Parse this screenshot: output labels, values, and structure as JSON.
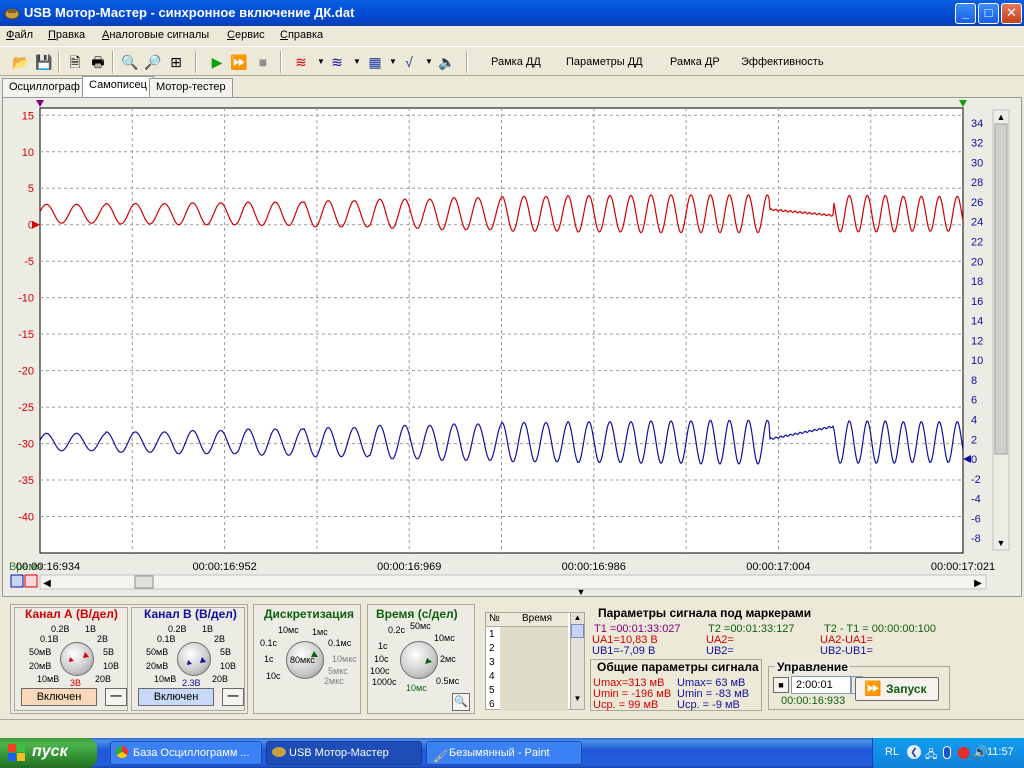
{
  "window": {
    "title": "USB Мотор-Мастер - синхронное включение ДК.dat",
    "min": "_",
    "max": "□",
    "close": "✕"
  },
  "menu": [
    "Файл",
    "Правка",
    "Аналоговые сигналы",
    "Сервис",
    "Справка"
  ],
  "toolbar": {
    "buttons": [
      "Рамка ДД",
      "Параметры ДД",
      "Рамка ДР",
      "Эффективность"
    ]
  },
  "tabs": [
    "Осциллограф",
    "Самописец",
    "Мотор-тестер"
  ],
  "chart_data": {
    "type": "line",
    "left_axis": {
      "ticks": [
        15,
        10,
        5,
        0,
        -5,
        -10,
        -15,
        -20,
        -25,
        -30,
        -35,
        -40
      ],
      "range": [
        -45,
        16
      ],
      "color": "#d40000"
    },
    "right_axis": {
      "ticks": [
        34,
        32,
        30,
        28,
        26,
        24,
        22,
        20,
        18,
        16,
        14,
        12,
        10,
        8,
        6,
        4,
        2,
        0,
        -2,
        -4,
        -6,
        -8
      ],
      "range": [
        -9.5,
        35.5
      ],
      "color": "#1010a0"
    },
    "x_ticks": [
      "00:00:16:934",
      "00:00:16:952",
      "00:00:16:969",
      "00:00:16:986",
      "00:00:17:004",
      "00:00:17:021"
    ],
    "x_label": "Время",
    "grid": true,
    "series": [
      {
        "color": "#d40000",
        "center": 1.5,
        "amplitudes": [
          1.3,
          1.4,
          1.5,
          1.6,
          1.8,
          2.0,
          2.2,
          2.4,
          2.5,
          2.6,
          2.6,
          2.6,
          2.5,
          2.4
        ],
        "periods": [
          30,
          29,
          28,
          27,
          26,
          25,
          24,
          22,
          21,
          20,
          19,
          18,
          18,
          18
        ]
      },
      {
        "color": "#1010a0",
        "center": -29.8,
        "amplitudes": [
          1.2,
          1.4,
          1.6,
          1.8,
          2.0,
          2.3,
          2.5,
          2.7,
          2.8,
          2.9,
          3.0,
          3.0,
          2.9,
          2.8
        ],
        "periods": [
          30,
          29,
          28,
          27,
          26,
          25,
          24,
          22,
          21,
          20,
          19,
          18,
          18,
          18
        ]
      }
    ],
    "markers": {
      "left_label": "0",
      "right_label": "0"
    }
  },
  "panels": {
    "channel_a": {
      "title": "Канал А (В/дел)",
      "labels": [
        "0.2В",
        "1В",
        "0.1В",
        "2В",
        "50мВ",
        "5В",
        "20мВ",
        "10В",
        "10мВ",
        "20В"
      ],
      "value": "3В",
      "on_label": "Включен",
      "minus": "—"
    },
    "channel_b": {
      "title": "Канал В (В/дел)",
      "labels": [
        "0.2В",
        "1В",
        "0.1В",
        "2В",
        "50мВ",
        "5В",
        "20мВ",
        "10В",
        "10мВ",
        "20В"
      ],
      "value": "2.3В",
      "on_label": "Включен",
      "minus": "—"
    },
    "discretization": {
      "title": "Дискретизация",
      "labels": [
        "10мс",
        "1мс",
        "0.1с",
        "0.1мс",
        "1с",
        "10мкс",
        "10с",
        "5мкс",
        "2мкс"
      ],
      "value": "80мкс"
    },
    "time": {
      "title": "Время (с/дел)",
      "labels": [
        "0.2с",
        "50мс",
        "1с",
        "10мс",
        "10с",
        "2мс",
        "100с",
        "0.5мс",
        "1000с",
        "10мс"
      ],
      "value": "10мс"
    },
    "table": {
      "col_num": "№",
      "col_time": "Время",
      "rows": [
        "1",
        "2",
        "3",
        "4",
        "5",
        "6"
      ]
    },
    "markers_params": {
      "title": "Параметры сигнала под маркерами",
      "t1": "T1 =00:01:33:027",
      "ua1": "UА1=10,83 В",
      "ub1": "UВ1=-7,09 В",
      "t2": "T2 =00:01:33:127",
      "ua2": "UА2=",
      "ub2": "UВ2=",
      "dt": "T2 - T1 = 00:00:00:100",
      "dua": "UА2-UА1=",
      "dub": "UВ2-UВ1="
    },
    "general_params": {
      "title": "Общие параметры сигнала",
      "umax_a": "Umax=313 мВ",
      "umin_a": "Umin = -196 мВ",
      "ucp_a": "Uср. = 99 мВ",
      "umax_b": "Umax= 63 мВ",
      "umin_b": "Umin = -83 мВ",
      "ucp_b": "Uср. = -9 мВ"
    },
    "control": {
      "title": "Управление",
      "time_value": "2:00:01",
      "elapsed": "00:00:16:933",
      "start_label": "Запуск"
    }
  },
  "taskbar": {
    "start_label": "пуск",
    "tasks": [
      "База Осциллограмм ...",
      "USB Мотор-Мастер",
      "Безымянный - Paint"
    ],
    "lang": "RL",
    "clock": "11:57"
  }
}
